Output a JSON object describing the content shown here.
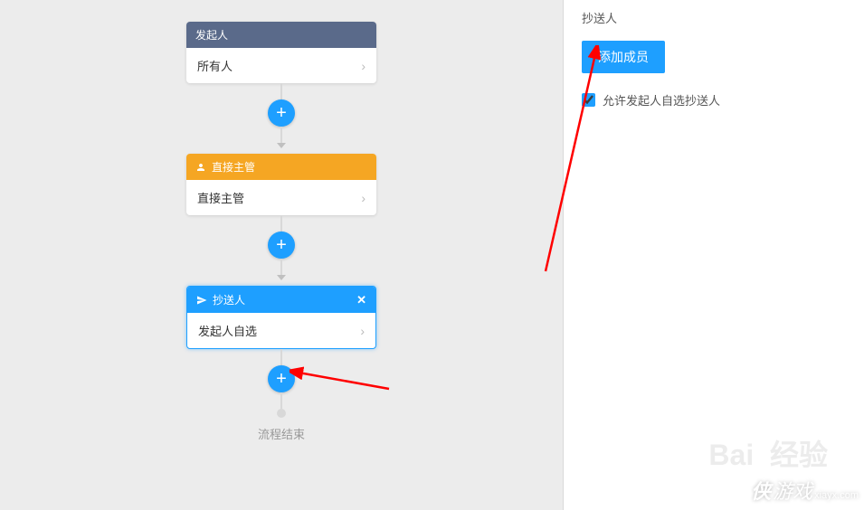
{
  "flow": {
    "initiator": {
      "head": "发起人",
      "body": "所有人"
    },
    "approver": {
      "head": "直接主管",
      "body": "直接主管"
    },
    "cc": {
      "head": "抄送人",
      "body": "发起人自选",
      "close": "✕"
    },
    "end": "流程结束",
    "plus": "+"
  },
  "panel": {
    "title": "抄送人",
    "add_member": "添加成员",
    "allow_self_select": "允许发起人自选抄送人",
    "checked": true
  },
  "watermark": {
    "main": "侠",
    "game": "游戏",
    "url": "xiayx.com"
  }
}
